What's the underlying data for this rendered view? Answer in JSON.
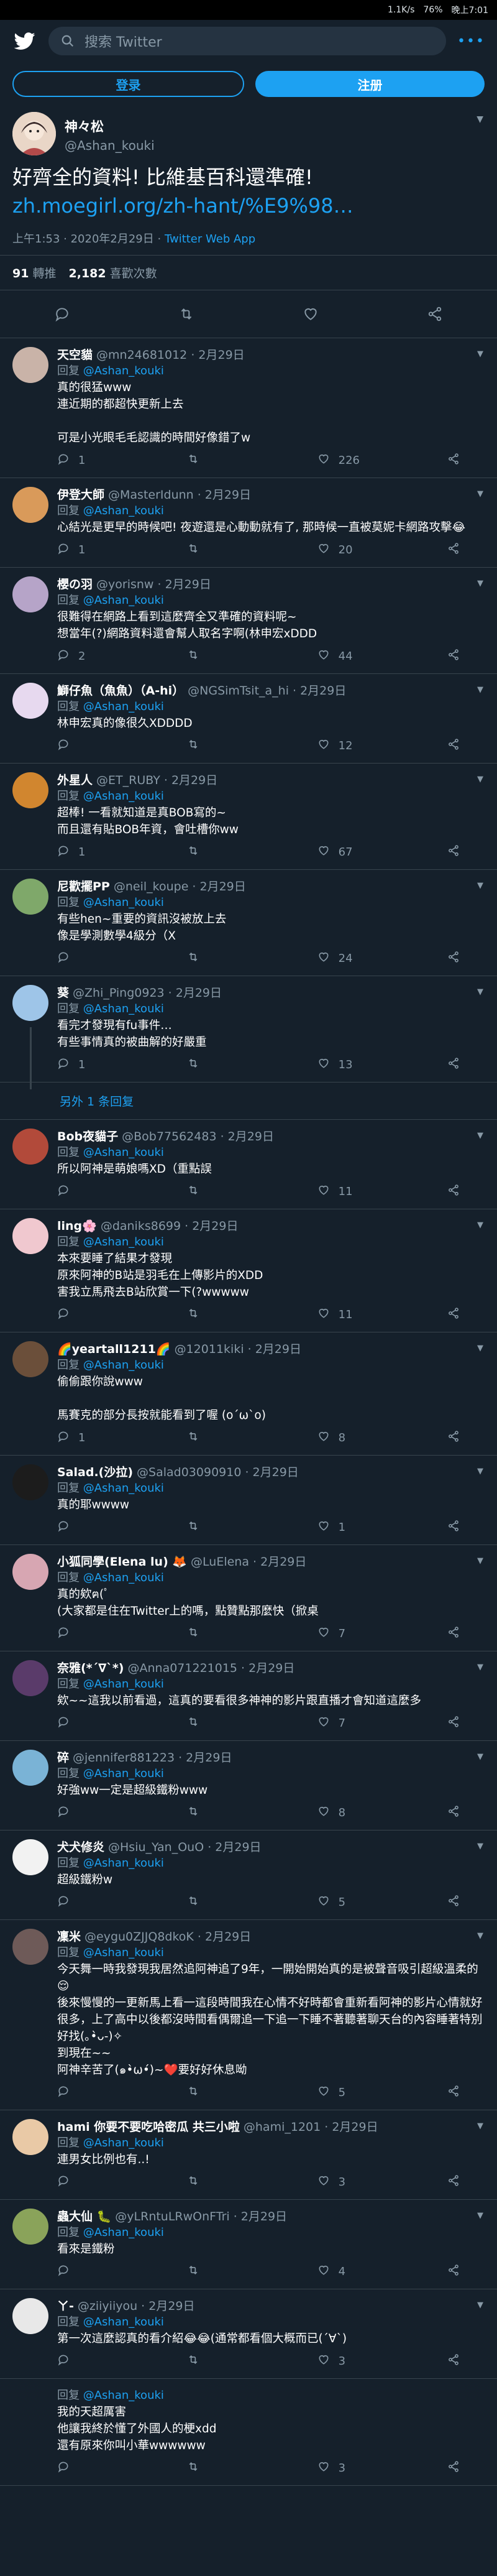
{
  "status": {
    "network": "1.1K/s",
    "battery": "76%",
    "time": "晚上7:01"
  },
  "header": {
    "search_placeholder": "搜索 Twitter",
    "more": "•••"
  },
  "auth": {
    "login": "登录",
    "signup": "注册"
  },
  "main_tweet": {
    "name": "神々松",
    "handle": "@Ashan_kouki",
    "text": "好齊全的資料! 比維基百科還準確!",
    "link": "zh.moegirl.org/zh-hant/%E9%98…",
    "time": "上午1:53 · 2020年2月29日",
    "source": "Twitter Web App",
    "retweets_count": "91",
    "retweets_label": "轉推",
    "likes_count": "2,182",
    "likes_label": "喜歡次數"
  },
  "reply_prefix": "回复",
  "reply_target": "@Ashan_kouki",
  "show_more": "另外 1 条回复",
  "replies": [
    {
      "name": "天空貓",
      "handle": "@mn24681012 · 2月29日",
      "lines": [
        "真的很猛www",
        "連近期的都超快更新上去",
        "",
        "可是小光眼毛毛認識的時間好像錯了w"
      ],
      "c": "1",
      "r": "",
      "l": "226",
      "av": "#c9b3a8"
    },
    {
      "name": "伊登大師",
      "handle": "@MasterIdunn · 2月29日",
      "lines": [
        "心結光是更早的時候吧! 夜遊還是心動動就有了, 那時候一直被莫妮卡網路攻擊😂"
      ],
      "c": "1",
      "r": "",
      "l": "20",
      "av": "#d99a5a"
    },
    {
      "name": "櫻の羽",
      "handle": "@yorisnw · 2月29日",
      "lines": [
        "很難得在網路上看到這麼齊全又準確的資料呢~",
        "想當年(?)網路資料還會幫人取名字啊(林申宏xDDD"
      ],
      "c": "2",
      "r": "",
      "l": "44",
      "av": "#b6a4c8"
    },
    {
      "name": "鰤仔魚（魚魚）（A-hi）",
      "handle": "@NGSimTsit_a_hi · 2月29日",
      "lines": [
        "林申宏真的像很久XDDDD"
      ],
      "c": "",
      "r": "",
      "l": "12",
      "av": "#e7d9ef"
    },
    {
      "name": "外星人",
      "handle": "@ET_RUBY · 2月29日",
      "lines": [
        "超棒! 一看就知道是真BOB寫的~",
        "而且還有貼BOB年資，會吐槽你ww"
      ],
      "c": "1",
      "r": "",
      "l": "67",
      "av": "#d1862f"
    },
    {
      "name": "尼歡擺PP",
      "handle": "@neil_koupe · 2月29日",
      "lines": [
        "有些hen~重要的資訊沒被放上去",
        "像是學測數學4級分（X"
      ],
      "c": "",
      "r": "",
      "l": "24",
      "av": "#7fa86a"
    },
    {
      "name": "葵",
      "handle": "@Zhi_Ping0923 · 2月29日",
      "lines": [
        "看完才發現有fu事件…",
        "有些事情真的被曲解的好嚴重"
      ],
      "c": "1",
      "r": "",
      "l": "13",
      "av": "#9ec5e8"
    },
    {
      "name": "Bob夜貓子",
      "handle": "@Bob77562483 · 2月29日",
      "lines": [
        "所以阿神是萌娘嗎XD（重點誤"
      ],
      "c": "",
      "r": "",
      "l": "11",
      "av": "#b24a3a"
    },
    {
      "name": "ling🌸",
      "handle": "@daniks8699 · 2月29日",
      "lines": [
        "本來要睡了結果才發現",
        "原來阿神的B站是羽毛在上傳影片的XDD",
        "害我立馬飛去B站欣賞一下(?wwwww"
      ],
      "c": "",
      "r": "",
      "l": "11",
      "av": "#f0c8cf"
    },
    {
      "name": "🌈yeartall1211🌈",
      "handle": "@12011kiki · 2月29日",
      "lines": [
        "偷偷跟你說www",
        "",
        "馬賽克的部分長按就能看到了喔 (o´ω`o)"
      ],
      "c": "1",
      "r": "",
      "l": "8",
      "av": "#6b4f3a"
    },
    {
      "name": "Salad.(沙拉)",
      "handle": "@Salad03090910 · 2月29日",
      "lines": [
        "真的耶wwww"
      ],
      "c": "",
      "r": "",
      "l": "1",
      "av": "#1c1c1c"
    },
    {
      "name": "小狐同學(Elena lu) 🦊",
      "handle": "@LuElena · 2月29日",
      "lines": [
        "真的欸ฅ(ﾟ",
        "(大家都是住在Twitter上的嗎，點贊點那麼快（掀桌"
      ],
      "c": "",
      "r": "",
      "l": "7",
      "av": "#d7a6b2"
    },
    {
      "name": "奈雅(*´∇`*)",
      "handle": "@Anna071221015 · 2月29日",
      "lines": [
        "欸~~這我以前看過，這真的要看很多神神的影片跟直播才會知道這麼多"
      ],
      "c": "",
      "r": "",
      "l": "7",
      "av": "#5a3b6a"
    },
    {
      "name": "碎",
      "handle": "@jennifer881223 · 2月29日",
      "lines": [
        "好強ww一定是超級鐵粉www"
      ],
      "c": "",
      "r": "",
      "l": "8",
      "av": "#7ab3d6"
    },
    {
      "name": "犬犬修炎",
      "handle": "@Hsiu_Yan_OuO · 2月29日",
      "lines": [
        "超級鐵粉w"
      ],
      "c": "",
      "r": "",
      "l": "5",
      "av": "#f2f2f2"
    },
    {
      "name": "凜米",
      "handle": "@eygu0ZJJQ8dkoK · 2月29日",
      "lines": [
        "今天舞一時我發現我居然追阿神追了9年，一開始開始真的是被聲音吸引超級溫柔的😌",
        "後來慢慢的一更新馬上看一這段時間我在心情不好時都會重新看阿神的影片心情就好很多，上了高中以後都沒時間看偶爾追一下追一下睡不著聽著聊天台的內容睡著特別好找(｡•̀ᴗ-)✧",
        "到現在~~",
        "阿神辛苦了(๑•̀ω•́)~❤️要好好休息呦"
      ],
      "c": "",
      "r": "",
      "l": "5",
      "av": "#6e5a58"
    },
    {
      "name": "hami 你要不要吃哈密瓜 共三小啦",
      "handle": "@hami_1201 · 2月29日",
      "lines": [
        "連男女比例也有..!"
      ],
      "c": "",
      "r": "",
      "l": "3",
      "av": "#e9c9a6"
    },
    {
      "name": "蟲大仙 🐛",
      "handle": "@yLRntuLRwOnFTri · 2月29日",
      "lines": [
        "看來是鐵粉"
      ],
      "c": "",
      "r": "",
      "l": "4",
      "av": "#8aa35a"
    },
    {
      "name": "ㄚ-",
      "handle": "@ziiyiiyou · 2月29日",
      "lines": [
        "第一次這麼認真的看介紹😂😂(通常都看個大概而已(´∀`)"
      ],
      "c": "",
      "r": "",
      "l": "3",
      "av": "#e8e8e8"
    }
  ],
  "last_partial": {
    "lines": [
      "我的天超厲害",
      "他讓我終於懂了外國人的梗xdd",
      "還有原來你叫小華wwwwww"
    ],
    "c": "",
    "r": "",
    "l": "3"
  }
}
